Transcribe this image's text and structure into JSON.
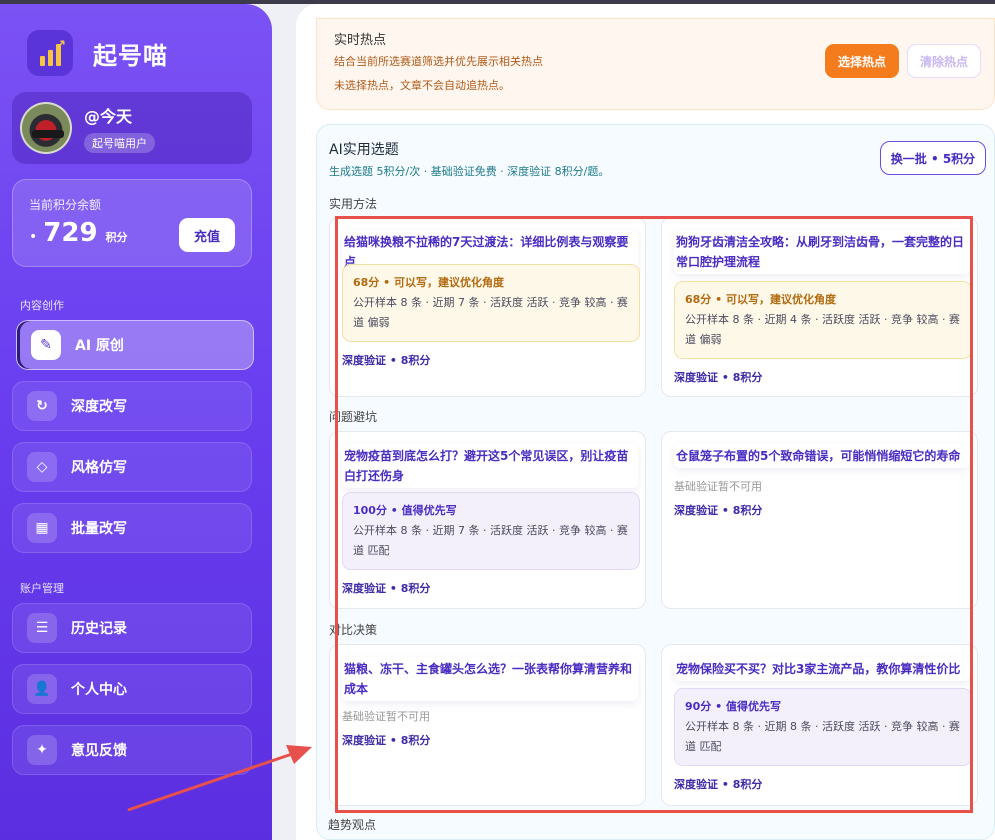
{
  "app": {
    "name": "起号喵"
  },
  "user": {
    "name": "@今天",
    "badge": "起号喵用户"
  },
  "credits": {
    "label": "当前积分余额",
    "dot": "•",
    "value": "729",
    "unit": "积分",
    "recharge_label": "充值"
  },
  "sidebar": {
    "section_create": "内容创作",
    "section_account": "账户管理",
    "items": [
      {
        "label": "AI 原创",
        "icon": "pen-icon",
        "glyph": "✎"
      },
      {
        "label": "深度改写",
        "icon": "refresh-icon",
        "glyph": "↻"
      },
      {
        "label": "风格仿写",
        "icon": "diamond-icon",
        "glyph": "◇"
      },
      {
        "label": "批量改写",
        "icon": "grid-icon",
        "glyph": "▦"
      },
      {
        "label": "历史记录",
        "icon": "list-icon",
        "glyph": "☰"
      },
      {
        "label": "个人中心",
        "icon": "user-icon",
        "glyph": "👤"
      },
      {
        "label": "意见反馈",
        "icon": "sparkle-icon",
        "glyph": "✦"
      }
    ]
  },
  "hotspot": {
    "title": "实时热点",
    "desc": "结合当前所选赛道筛选并优先展示相关热点",
    "note": "未选择热点，文章不会自动追热点。",
    "select_label": "选择热点",
    "clear_label": "清除热点"
  },
  "ai_topics": {
    "title": "AI实用选题",
    "subtitle": "生成选题 5积分/次 · 基础验证免费 · 深度验证 8积分/题。",
    "batch_label": "换一批 • 5积分",
    "categories": [
      "实用方法",
      "问题避坑",
      "对比决策",
      "趋势观点"
    ],
    "cards": [
      {
        "title": "给猫咪换粮不拉稀的7天过渡法：详细比例表与观察要点",
        "score": "68分 • 可以写，建议优化角度",
        "detail": "公开样本 8 条 · 近期 7 条 · 活跃度 活跃 · 竞争 较高 · 赛道 偏弱",
        "verify": "深度验证 • 8积分"
      },
      {
        "title": "狗狗牙齿清洁全攻略：从刷牙到洁齿骨，一套完整的日常口腔护理流程",
        "score": "68分 • 可以写，建议优化角度",
        "detail": "公开样本 8 条 · 近期 4 条 · 活跃度 活跃 · 竞争 较高 · 赛道 偏弱",
        "verify": "深度验证 • 8积分"
      },
      {
        "title": "宠物疫苗到底怎么打？避开这5个常见误区，别让疫苗白打还伤身",
        "score": "100分 • 值得优先写",
        "detail": "公开样本 8 条 · 近期 7 条 · 活跃度 活跃 · 竞争 较高 · 赛道 匹配",
        "verify": "深度验证 • 8积分"
      },
      {
        "title": "仓鼠笼子布置的5个致命错误，可能悄悄缩短它的寿命",
        "na": "基础验证暂不可用",
        "verify": "深度验证 • 8积分"
      },
      {
        "title": "猫粮、冻干、主食罐头怎么选？一张表帮你算清营养和成本",
        "na": "基础验证暂不可用",
        "verify": "深度验证 • 8积分"
      },
      {
        "title": "宠物保险买不买？对比3家主流产品，教你算清性价比",
        "score": "90分 • 值得优先写",
        "detail": "公开样本 8 条 · 近期 8 条 · 活跃度 活跃 · 竞争 较高 · 赛道 匹配",
        "verify": "深度验证 • 8积分"
      }
    ]
  },
  "colors": {
    "accent": "#6a3ff0",
    "orange": "#f47c1c",
    "annotation": "#e8504c"
  }
}
